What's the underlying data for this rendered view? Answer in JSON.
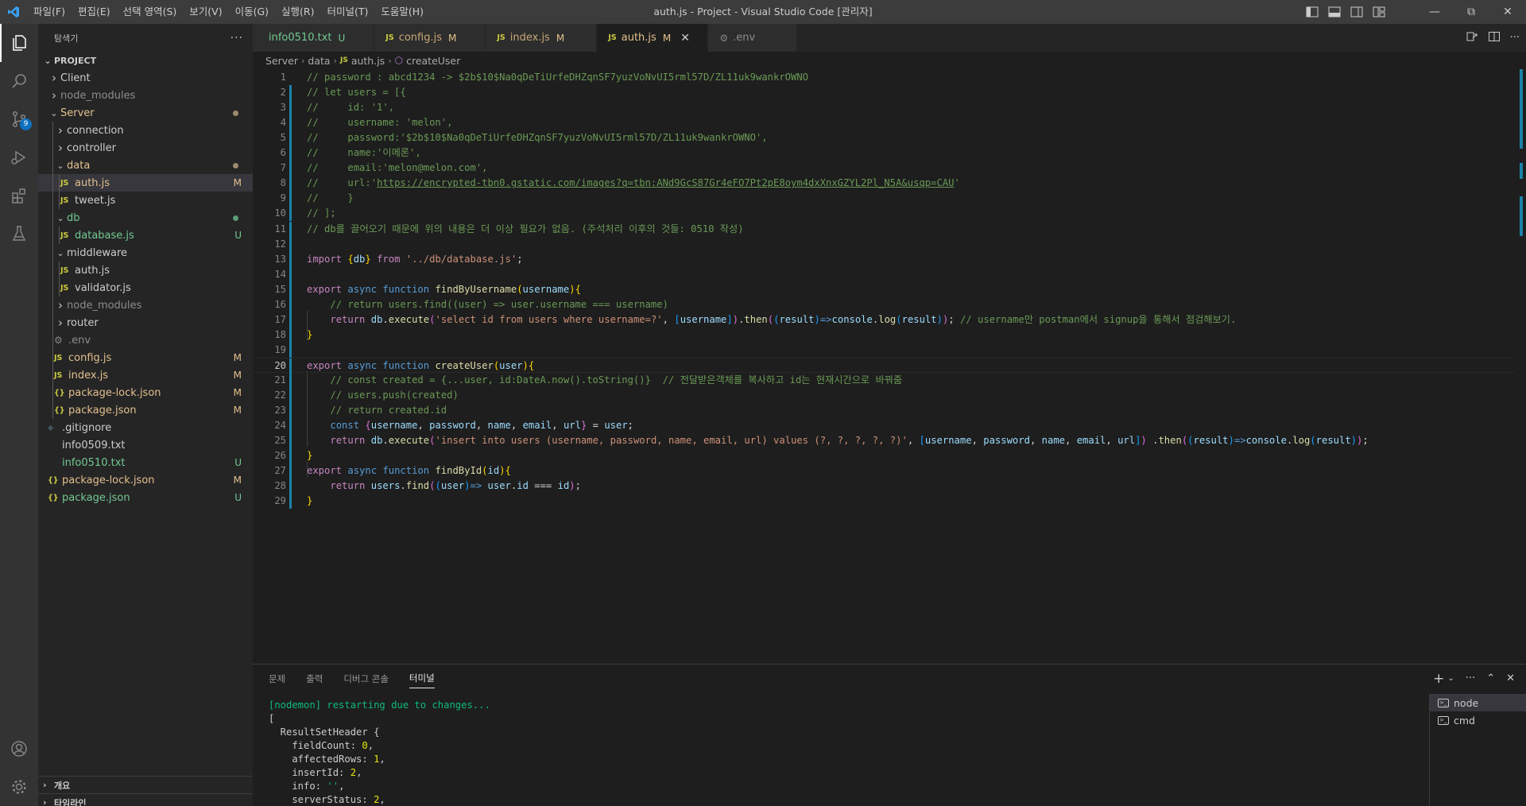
{
  "window": {
    "title": "auth.js - Project - Visual Studio Code [관리자]",
    "menu": [
      "파일(F)",
      "편집(E)",
      "선택 영역(S)",
      "보기(V)",
      "이동(G)",
      "실행(R)",
      "터미널(T)",
      "도움말(H)"
    ]
  },
  "activity": {
    "scm_badge": "9"
  },
  "sidebar": {
    "title": "탐색기",
    "more": "···",
    "root": "PROJECT",
    "items": [
      {
        "label": "Client",
        "kind": "folder",
        "open": false,
        "depth": 0,
        "status": "",
        "color": "normal"
      },
      {
        "label": "node_modules",
        "kind": "folder",
        "open": false,
        "depth": 0,
        "status": "",
        "color": "ignored"
      },
      {
        "label": "Server",
        "kind": "folder",
        "open": true,
        "depth": 0,
        "status": "dot-mod",
        "color": "modified"
      },
      {
        "label": "connection",
        "kind": "folder",
        "open": false,
        "depth": 1,
        "status": "",
        "color": "normal"
      },
      {
        "label": "controller",
        "kind": "folder",
        "open": false,
        "depth": 1,
        "status": "",
        "color": "normal"
      },
      {
        "label": "data",
        "kind": "folder",
        "open": true,
        "depth": 1,
        "status": "dot-mod",
        "color": "modified"
      },
      {
        "label": "auth.js",
        "kind": "js",
        "depth": 2,
        "status": "M",
        "color": "modified",
        "selected": true
      },
      {
        "label": "tweet.js",
        "kind": "js",
        "depth": 2,
        "status": "",
        "color": "normal"
      },
      {
        "label": "db",
        "kind": "folder",
        "open": true,
        "depth": 1,
        "status": "dot-unt",
        "color": "untracked"
      },
      {
        "label": "database.js",
        "kind": "js",
        "depth": 2,
        "status": "U",
        "color": "untracked"
      },
      {
        "label": "middleware",
        "kind": "folder",
        "open": true,
        "depth": 1,
        "status": "",
        "color": "normal"
      },
      {
        "label": "auth.js",
        "kind": "js",
        "depth": 2,
        "status": "",
        "color": "normal"
      },
      {
        "label": "validator.js",
        "kind": "js",
        "depth": 2,
        "status": "",
        "color": "normal"
      },
      {
        "label": "node_modules",
        "kind": "folder",
        "open": false,
        "depth": 1,
        "status": "",
        "color": "ignored"
      },
      {
        "label": "router",
        "kind": "folder",
        "open": false,
        "depth": 1,
        "status": "",
        "color": "normal"
      },
      {
        "label": ".env",
        "kind": "gear",
        "depth": 1,
        "status": "",
        "color": "ignored"
      },
      {
        "label": "config.js",
        "kind": "js",
        "depth": 1,
        "status": "M",
        "color": "modified"
      },
      {
        "label": "index.js",
        "kind": "js",
        "depth": 1,
        "status": "M",
        "color": "modified"
      },
      {
        "label": "package-lock.json",
        "kind": "json",
        "depth": 1,
        "status": "M",
        "color": "modified"
      },
      {
        "label": "package.json",
        "kind": "json",
        "depth": 1,
        "status": "M",
        "color": "modified"
      },
      {
        "label": ".gitignore",
        "kind": "git",
        "depth": 0,
        "status": "",
        "color": "normal"
      },
      {
        "label": "info0509.txt",
        "kind": "txt",
        "depth": 0,
        "status": "",
        "color": "normal"
      },
      {
        "label": "info0510.txt",
        "kind": "txt",
        "depth": 0,
        "status": "U",
        "color": "untracked"
      },
      {
        "label": "package-lock.json",
        "kind": "json",
        "depth": 0,
        "status": "M",
        "color": "modified"
      },
      {
        "label": "package.json",
        "kind": "json",
        "depth": 0,
        "status": "U",
        "color": "untracked"
      }
    ],
    "outline": "개요",
    "timeline": "타임라인"
  },
  "tabs": [
    {
      "label": "info0510.txt",
      "status": "U",
      "icon": "txt",
      "active": false
    },
    {
      "label": "config.js",
      "status": "M",
      "icon": "js",
      "active": false
    },
    {
      "label": "index.js",
      "status": "M",
      "icon": "js",
      "active": false
    },
    {
      "label": "auth.js",
      "status": "M",
      "icon": "js",
      "active": true
    },
    {
      "label": ".env",
      "status": "",
      "icon": "gear",
      "active": false
    }
  ],
  "breadcrumb": [
    "Server",
    "data",
    "auth.js",
    "createUser"
  ],
  "editor": {
    "current_line": 20,
    "modified_lines": [
      2,
      3,
      4,
      5,
      6,
      7,
      8,
      9,
      10,
      11,
      12,
      13,
      14,
      15,
      16,
      17,
      18,
      19,
      20,
      21,
      22,
      23,
      24,
      25,
      26,
      27,
      28,
      29
    ],
    "lines": [
      [
        [
          "c",
          "// password : abcd1234 -> $2b$10$Na0qDeTiUrfeDHZqnSF7yuzVoNvUI5rml57D/ZL11uk9wankrOWNO"
        ]
      ],
      [
        [
          "c",
          "// let users = [{"
        ]
      ],
      [
        [
          "c",
          "//     id: '1',"
        ]
      ],
      [
        [
          "c",
          "//     username: 'melon',"
        ]
      ],
      [
        [
          "c",
          "//     password:'$2b$10$Na0qDeTiUrfeDHZqnSF7yuzVoNvUI5rml57D/ZL11uk9wankrOWNO',"
        ]
      ],
      [
        [
          "c",
          "//     name:'이메론',"
        ]
      ],
      [
        [
          "c",
          "//     email:'melon@melon.com',"
        ]
      ],
      [
        [
          "c",
          "//     url:'"
        ],
        [
          "u",
          "https://encrypted-tbn0.gstatic.com/images?q=tbn:ANd9GcS87Gr4eFO7Pt2pE8oym4dxXnxGZYL2Pl_N5A&usqp=CAU"
        ],
        [
          "c",
          "'"
        ]
      ],
      [
        [
          "c",
          "//     }"
        ]
      ],
      [
        [
          "c",
          "// ];"
        ]
      ],
      [
        [
          "c",
          "// db를 끌어오기 때문에 위의 내용은 더 이상 필요가 없음. (주석처리 이후의 것들: 0510 작성)"
        ]
      ],
      [],
      [
        [
          "kc",
          "import "
        ],
        [
          "b1",
          "{"
        ],
        [
          "v",
          "db"
        ],
        [
          "b1",
          "}"
        ],
        [
          "kc",
          " from "
        ],
        [
          "s",
          "'../db/database.js'"
        ],
        [
          "p",
          ";"
        ]
      ],
      [],
      [
        [
          "kc",
          "export "
        ],
        [
          "k",
          "async "
        ],
        [
          "k",
          "function "
        ],
        [
          "f",
          "findByUsername"
        ],
        [
          "b1",
          "("
        ],
        [
          "v",
          "username"
        ],
        [
          "b1",
          ")"
        ],
        [
          "b1",
          "{"
        ]
      ],
      [
        [
          "p",
          "    "
        ],
        [
          "c",
          "// return users.find((user) => user.username === username)"
        ]
      ],
      [
        [
          "p",
          "    "
        ],
        [
          "kc",
          "return "
        ],
        [
          "v",
          "db"
        ],
        [
          "p",
          "."
        ],
        [
          "f",
          "execute"
        ],
        [
          "b2",
          "("
        ],
        [
          "s",
          "'select id from users where username=?'"
        ],
        [
          "p",
          ", "
        ],
        [
          "b3",
          "["
        ],
        [
          "v",
          "username"
        ],
        [
          "b3",
          "]"
        ],
        [
          "b2",
          ")"
        ],
        [
          "p",
          "."
        ],
        [
          "f",
          "then"
        ],
        [
          "b2",
          "("
        ],
        [
          "b3",
          "("
        ],
        [
          "v",
          "result"
        ],
        [
          "b3",
          ")"
        ],
        [
          "k",
          "=>"
        ],
        [
          "v",
          "console"
        ],
        [
          "p",
          "."
        ],
        [
          "f",
          "log"
        ],
        [
          "b3",
          "("
        ],
        [
          "v",
          "result"
        ],
        [
          "b3",
          ")"
        ],
        [
          "b2",
          ")"
        ],
        [
          "p",
          "; "
        ],
        [
          "c",
          "// username만 postman에서 signup을 통해서 점검해보기."
        ]
      ],
      [
        [
          "b1",
          "}"
        ]
      ],
      [],
      [
        [
          "kc",
          "export "
        ],
        [
          "k",
          "async "
        ],
        [
          "k",
          "function "
        ],
        [
          "f",
          "createUser"
        ],
        [
          "b1",
          "("
        ],
        [
          "v",
          "user"
        ],
        [
          "b1",
          ")"
        ],
        [
          "b1",
          "{"
        ]
      ],
      [
        [
          "p",
          "    "
        ],
        [
          "c",
          "// const created = {...user, id:DateA.now().toString()}  // 전달받은객체를 복사하고 id는 현재시간으로 바꿔줌"
        ]
      ],
      [
        [
          "p",
          "    "
        ],
        [
          "c",
          "// users.push(created)"
        ]
      ],
      [
        [
          "p",
          "    "
        ],
        [
          "c",
          "// return created.id"
        ]
      ],
      [
        [
          "p",
          "    "
        ],
        [
          "k",
          "const "
        ],
        [
          "b2",
          "{"
        ],
        [
          "v",
          "username"
        ],
        [
          "p",
          ", "
        ],
        [
          "v",
          "password"
        ],
        [
          "p",
          ", "
        ],
        [
          "v",
          "name"
        ],
        [
          "p",
          ", "
        ],
        [
          "v",
          "email"
        ],
        [
          "p",
          ", "
        ],
        [
          "v",
          "url"
        ],
        [
          "b2",
          "}"
        ],
        [
          "p",
          " = "
        ],
        [
          "v",
          "user"
        ],
        [
          "p",
          ";"
        ]
      ],
      [
        [
          "p",
          "    "
        ],
        [
          "kc",
          "return "
        ],
        [
          "v",
          "db"
        ],
        [
          "p",
          "."
        ],
        [
          "f",
          "execute"
        ],
        [
          "b2",
          "("
        ],
        [
          "s",
          "'insert into users (username, password, name, email, url) values (?, ?, ?, ?, ?)'"
        ],
        [
          "p",
          ", "
        ],
        [
          "b3",
          "["
        ],
        [
          "v",
          "username"
        ],
        [
          "p",
          ", "
        ],
        [
          "v",
          "password"
        ],
        [
          "p",
          ", "
        ],
        [
          "v",
          "name"
        ],
        [
          "p",
          ", "
        ],
        [
          "v",
          "email"
        ],
        [
          "p",
          ", "
        ],
        [
          "v",
          "url"
        ],
        [
          "b3",
          "]"
        ],
        [
          "b2",
          ")"
        ],
        [
          "p",
          " ."
        ],
        [
          "f",
          "then"
        ],
        [
          "b2",
          "("
        ],
        [
          "b3",
          "("
        ],
        [
          "v",
          "result"
        ],
        [
          "b3",
          ")"
        ],
        [
          "k",
          "=>"
        ],
        [
          "v",
          "console"
        ],
        [
          "p",
          "."
        ],
        [
          "f",
          "log"
        ],
        [
          "b3",
          "("
        ],
        [
          "v",
          "result"
        ],
        [
          "b3",
          ")"
        ],
        [
          "b2",
          ")"
        ],
        [
          "p",
          ";"
        ]
      ],
      [
        [
          "b1",
          "}"
        ]
      ],
      [
        [
          "kc",
          "export "
        ],
        [
          "k",
          "async "
        ],
        [
          "k",
          "function "
        ],
        [
          "f",
          "findById"
        ],
        [
          "b1",
          "("
        ],
        [
          "v",
          "id"
        ],
        [
          "b1",
          ")"
        ],
        [
          "b1",
          "{"
        ]
      ],
      [
        [
          "p",
          "    "
        ],
        [
          "kc",
          "return "
        ],
        [
          "v",
          "users"
        ],
        [
          "p",
          "."
        ],
        [
          "f",
          "find"
        ],
        [
          "b2",
          "("
        ],
        [
          "b3",
          "("
        ],
        [
          "v",
          "user"
        ],
        [
          "b3",
          ")"
        ],
        [
          "k",
          "=> "
        ],
        [
          "v",
          "user"
        ],
        [
          "p",
          "."
        ],
        [
          "v",
          "id"
        ],
        [
          "p",
          " === "
        ],
        [
          "v",
          "id"
        ],
        [
          "b2",
          ")"
        ],
        [
          "p",
          ";"
        ]
      ],
      [
        [
          "b1",
          "}"
        ]
      ]
    ]
  },
  "panel": {
    "tabs": [
      "문제",
      "출력",
      "디버그 콘솔",
      "터미널"
    ],
    "active_tab": "터미널",
    "terminal_lines": [
      [
        [
          "green",
          "[nodemon] restarting due to changes..."
        ]
      ],
      [
        [
          "p",
          "["
        ]
      ],
      [
        [
          "p",
          "  ResultSetHeader {"
        ]
      ],
      [
        [
          "p",
          "    fieldCount: "
        ],
        [
          "yellow",
          "0"
        ],
        [
          "p",
          ","
        ]
      ],
      [
        [
          "p",
          "    affectedRows: "
        ],
        [
          "yellow",
          "1"
        ],
        [
          "p",
          ","
        ]
      ],
      [
        [
          "p",
          "    insertId: "
        ],
        [
          "yellow",
          "2"
        ],
        [
          "p",
          ","
        ]
      ],
      [
        [
          "p",
          "    info: "
        ],
        [
          "green",
          "''"
        ],
        [
          "p",
          ","
        ]
      ],
      [
        [
          "p",
          "    serverStatus: "
        ],
        [
          "yellow",
          "2"
        ],
        [
          "p",
          ","
        ]
      ]
    ],
    "terminals": [
      {
        "label": "node",
        "selected": true
      },
      {
        "label": "cmd",
        "selected": false
      }
    ]
  }
}
